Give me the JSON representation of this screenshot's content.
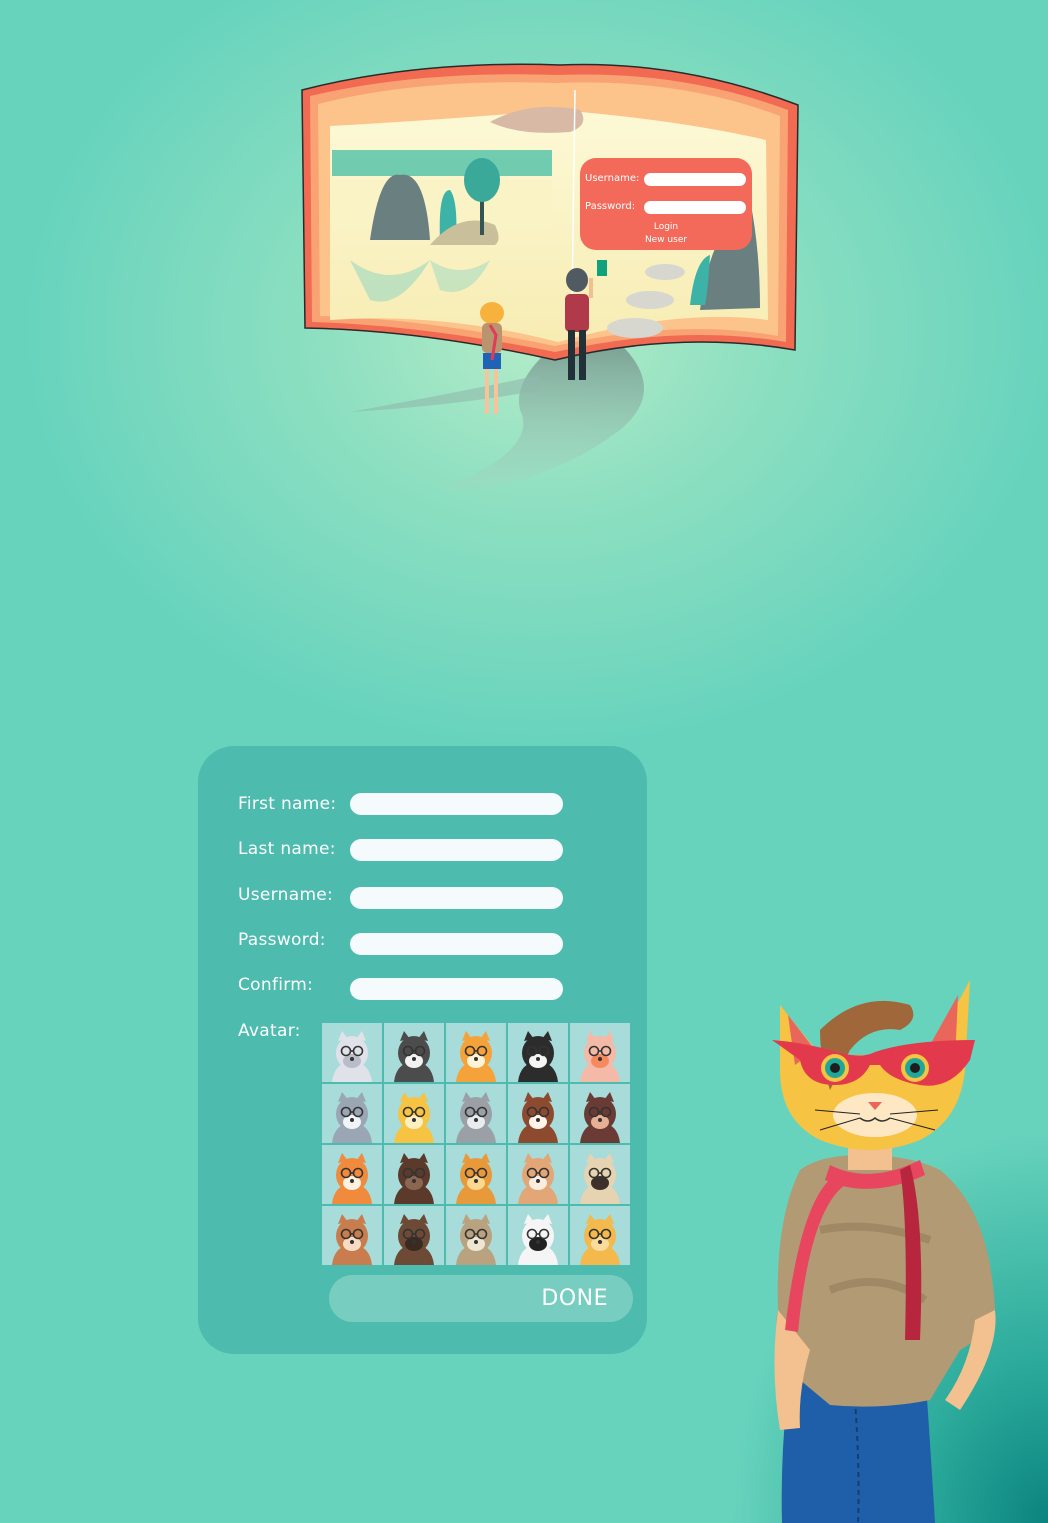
{
  "login_preview": {
    "username_label": "Username:",
    "password_label": "Password:",
    "login_link": "Login",
    "new_user_link": "New user"
  },
  "register_form": {
    "fields": [
      {
        "label": "First name:",
        "value": ""
      },
      {
        "label": "Last name:",
        "value": ""
      },
      {
        "label": "Username:",
        "value": ""
      },
      {
        "label": "Password:",
        "value": ""
      },
      {
        "label": "Confirm:",
        "value": ""
      }
    ],
    "avatar_label": "Avatar:",
    "avatars": [
      "wolf-avatar",
      "skunk-avatar",
      "squirrel-avatar",
      "badger-avatar",
      "pig-avatar",
      "raccoon-avatar",
      "cat-avatar",
      "koala-avatar",
      "dog-avatar",
      "monkey-avatar",
      "fox-avatar",
      "gorilla-avatar",
      "lion-avatar",
      "rabbit-avatar",
      "pug-avatar",
      "kangaroo-avatar",
      "bear-avatar",
      "deer-avatar",
      "panda-avatar",
      "giraffe-avatar"
    ],
    "done_label": "DONE"
  },
  "colors": {
    "background": "#67d3bd",
    "panel": "#4dbcae",
    "input": "#f5fbfd",
    "done_button": "#77cdc0",
    "login_box": "#f3695a",
    "avatar_tile": "#a7dcda"
  }
}
